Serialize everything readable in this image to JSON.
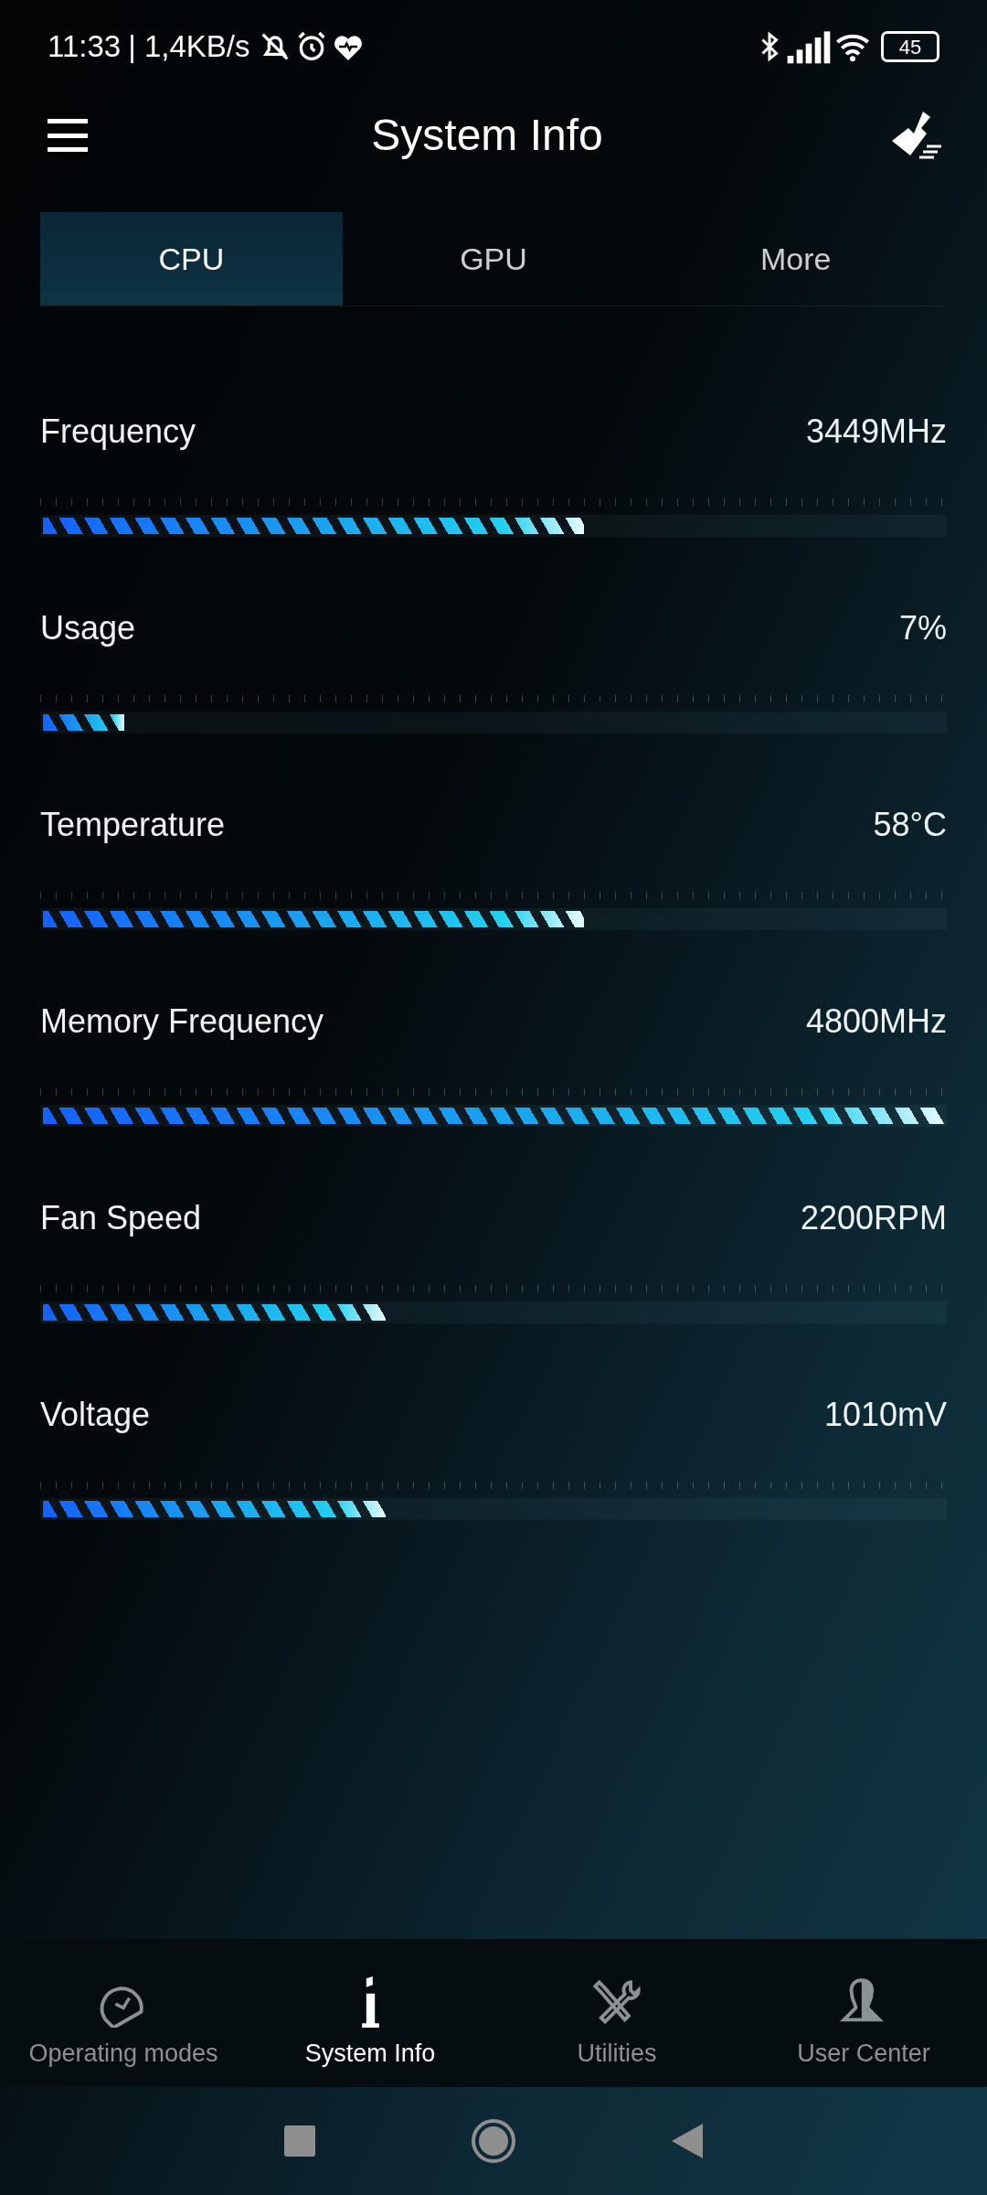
{
  "status_bar": {
    "time": "11:33",
    "speed": "| 1,4KB/s",
    "battery": "45"
  },
  "header": {
    "title": "System Info"
  },
  "tabs": [
    {
      "label": "CPU",
      "selected": true
    },
    {
      "label": "GPU",
      "selected": false
    },
    {
      "label": "More",
      "selected": false
    }
  ],
  "metrics": [
    {
      "name": "Frequency",
      "value": "3449MHz",
      "level": 0.6
    },
    {
      "name": "Usage",
      "value": "7%",
      "level": 0.09
    },
    {
      "name": "Temperature",
      "value": "58°C",
      "level": 0.6
    },
    {
      "name": "Memory Frequency",
      "value": "4800MHz",
      "level": 1.0
    },
    {
      "name": "Fan Speed",
      "value": "2200RPM",
      "level": 0.38
    },
    {
      "name": "Voltage",
      "value": "1010mV",
      "level": 0.38
    }
  ],
  "bottom_nav": [
    {
      "label": "Operating modes",
      "selected": false
    },
    {
      "label": "System Info",
      "selected": true
    },
    {
      "label": "Utilities",
      "selected": false
    },
    {
      "label": "User Center",
      "selected": false
    }
  ]
}
